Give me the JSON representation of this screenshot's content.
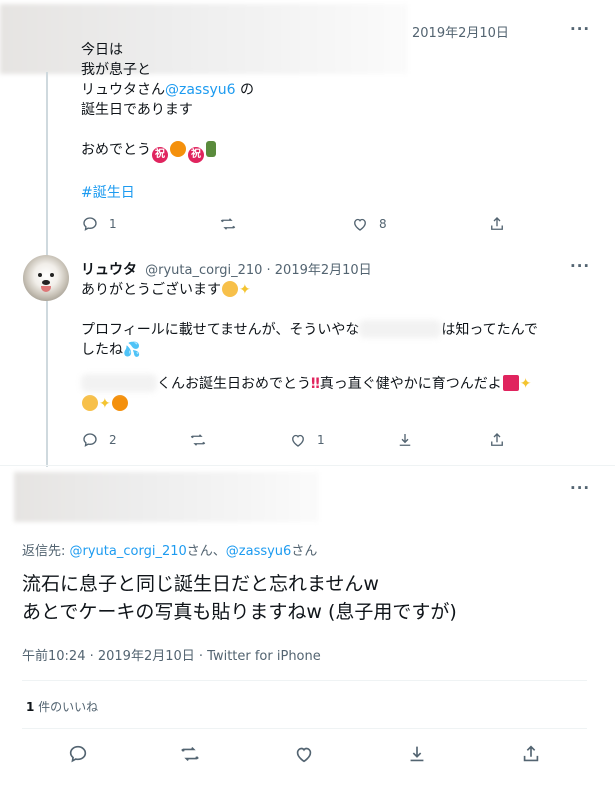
{
  "tweet1": {
    "date": "2019年2月10日",
    "more": "···",
    "lines": [
      "今日は",
      "我が息子と"
    ],
    "line3_pre": "リュウタさん",
    "line3_mention": "@zassyu6",
    "line3_post": " の",
    "line4": "誕生日であります",
    "line5": "おめでとう",
    "line5_emoji": [
      "祝",
      "🎊",
      "祝",
      "🍾"
    ],
    "hashtag": "#誕生日",
    "reply_count": "1",
    "like_count": "8"
  },
  "tweet2": {
    "name": "リュウタ",
    "handle_date": "@ryuta_corgi_210 · 2019年2月10日",
    "more": "···",
    "line1": "ありがとうございます",
    "line2a": "プロフィールに載せてませんが、そういやな",
    "line2b": "は知ってたんで",
    "line3": "したね",
    "line4": "くんお誕生日おめでとう",
    "line4b": "真っ直ぐ健やかに育つんだよ",
    "reply_count": "2",
    "like_count": "1"
  },
  "main": {
    "more": "···",
    "replying_label": "返信先: ",
    "replying_mention1": "@ryuta_corgi_210",
    "replying_mid": "さん、",
    "replying_mention2": "@zassyu6",
    "replying_end": "さん",
    "text_line1": "流石に息子と同じ誕生日だと忘れませんw",
    "text_line2": "あとでケーキの写真も貼りますねw (息子用ですが)",
    "time": "午前10:24 · 2019年2月10日 · Twitter for iPhone",
    "likes_count": "1",
    "likes_label": " 件のいいね"
  },
  "colors": {
    "link": "#1d9bf0",
    "muted": "#536471",
    "text": "#0f1419",
    "border": "#eff3f4"
  },
  "icons": [
    "reply-icon",
    "retweet-icon",
    "like-icon",
    "share-icon",
    "download-icon",
    "more-icon"
  ]
}
